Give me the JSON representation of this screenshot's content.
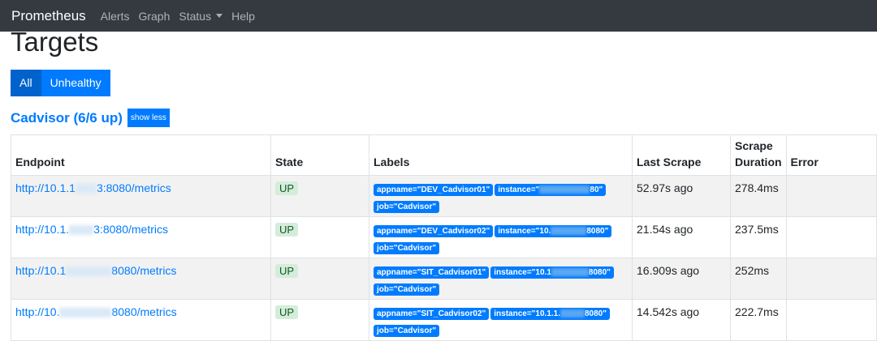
{
  "navbar": {
    "brand": "Prometheus",
    "items": [
      "Alerts",
      "Graph",
      "Status",
      "Help"
    ]
  },
  "page": {
    "title": "Targets",
    "filters": {
      "all": "All",
      "unhealthy": "Unhealthy"
    }
  },
  "job": {
    "title": "Cadvisor (6/6 up)",
    "toggle_label": "show less"
  },
  "table": {
    "headers": {
      "endpoint": "Endpoint",
      "state": "State",
      "labels": "Labels",
      "last_scrape": "Last Scrape",
      "scrape_duration": "Scrape Duration",
      "error": "Error"
    },
    "rows": [
      {
        "endpoint_a": "http://10.1.1",
        "endpoint_b": "3:8080/metrics",
        "state": "UP",
        "label_appname": "appname=\"DEV_Cadvisor01\"",
        "label_instance_a": "instance=\"",
        "label_instance_b": "80\"",
        "label_job": "job=\"Cadvisor\"",
        "last_scrape": "52.97s ago",
        "duration": "278.4ms",
        "error": ""
      },
      {
        "endpoint_a": "http://10.1.",
        "endpoint_b": "3:8080/metrics",
        "state": "UP",
        "label_appname": "appname=\"DEV_Cadvisor02\"",
        "label_instance_a": "instance=\"10.",
        "label_instance_b": "8080\"",
        "label_job": "job=\"Cadvisor\"",
        "last_scrape": "21.54s ago",
        "duration": "237.5ms",
        "error": ""
      },
      {
        "endpoint_a": "http://10.1",
        "endpoint_b": "8080/metrics",
        "state": "UP",
        "label_appname": "appname=\"SIT_Cadvisor01\"",
        "label_instance_a": "instance=\"10.1",
        "label_instance_b": "8080\"",
        "label_job": "job=\"Cadvisor\"",
        "last_scrape": "16.909s ago",
        "duration": "252ms",
        "error": ""
      },
      {
        "endpoint_a": "http://10.",
        "endpoint_b": "8080/metrics",
        "state": "UP",
        "label_appname": "appname=\"SIT_Cadvisor02\"",
        "label_instance_a": "instance=\"10.1.1.",
        "label_instance_b": "8080\"",
        "label_job": "job=\"Cadvisor\"",
        "last_scrape": "14.542s ago",
        "duration": "222.7ms",
        "error": ""
      }
    ]
  }
}
